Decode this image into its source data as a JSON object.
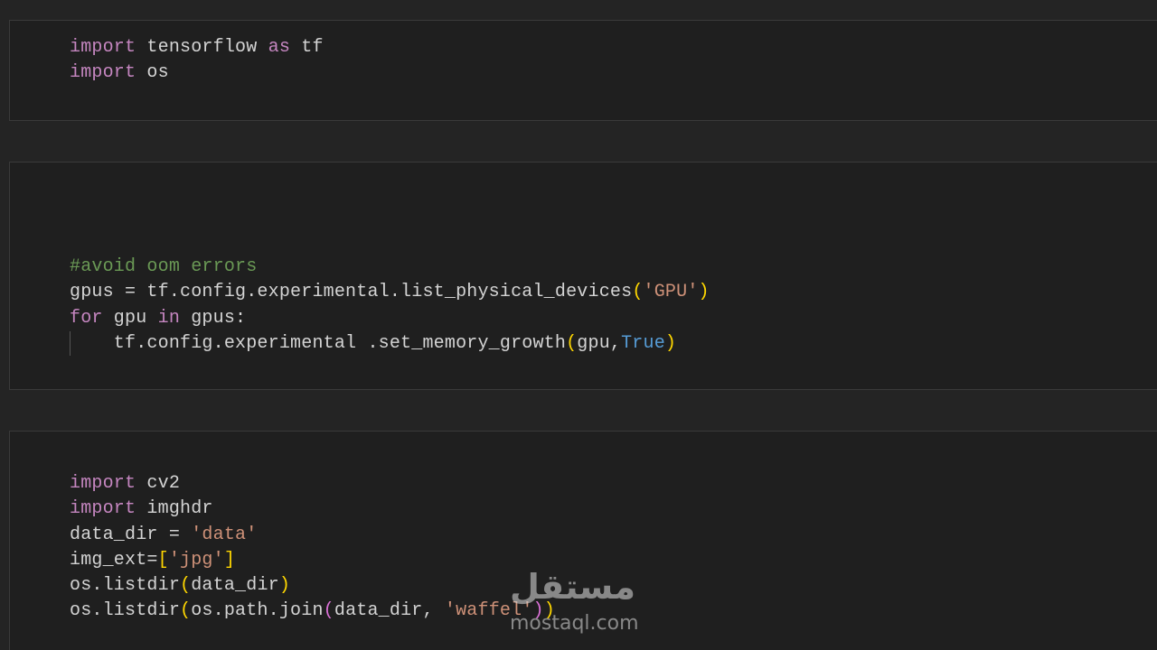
{
  "theme": {
    "background": "#242424",
    "cell_background": "#1f1f1f",
    "keyword": "#c586c0",
    "comment": "#6a9955",
    "string": "#ce9178",
    "constant": "#569cd6",
    "bracket_level_1": "#ffd700",
    "bracket_level_2": "#da70d6",
    "text": "#d4d4d4"
  },
  "cells": [
    {
      "lines": [
        [
          {
            "t": "import",
            "k": "kw"
          },
          {
            "t": " tensorflow ",
            "k": "p"
          },
          {
            "t": "as",
            "k": "kw"
          },
          {
            "t": " tf",
            "k": "p"
          }
        ],
        [
          {
            "t": "import",
            "k": "kw"
          },
          {
            "t": " os",
            "k": "p"
          }
        ]
      ]
    },
    {
      "lines": [
        [
          {
            "t": "#avoid oom errors",
            "k": "cm"
          }
        ],
        [
          {
            "t": "gpus = tf.config.experimental.list_physical_devices",
            "k": "p"
          },
          {
            "t": "(",
            "k": "b1"
          },
          {
            "t": "'GPU'",
            "k": "st"
          },
          {
            "t": ")",
            "k": "b1"
          }
        ],
        [
          {
            "t": "for",
            "k": "kw"
          },
          {
            "t": " gpu ",
            "k": "p"
          },
          {
            "t": "in",
            "k": "kw"
          },
          {
            "t": " gpus:",
            "k": "p"
          }
        ],
        [
          {
            "t": "    tf.config.experimental .set_memory_growth",
            "k": "p"
          },
          {
            "t": "(",
            "k": "b1"
          },
          {
            "t": "gpu,",
            "k": "p"
          },
          {
            "t": "True",
            "k": "cn"
          },
          {
            "t": ")",
            "k": "b1"
          }
        ]
      ]
    },
    {
      "lines": [
        [
          {
            "t": "import",
            "k": "kw"
          },
          {
            "t": " cv2",
            "k": "p"
          }
        ],
        [
          {
            "t": "import",
            "k": "kw"
          },
          {
            "t": " imghdr",
            "k": "p"
          }
        ],
        [
          {
            "t": "data_dir = ",
            "k": "p"
          },
          {
            "t": "'data'",
            "k": "st"
          }
        ],
        [
          {
            "t": "img_ext=",
            "k": "p"
          },
          {
            "t": "[",
            "k": "b1"
          },
          {
            "t": "'jpg'",
            "k": "st"
          },
          {
            "t": "]",
            "k": "b1"
          }
        ],
        [
          {
            "t": "os.listdir",
            "k": "p"
          },
          {
            "t": "(",
            "k": "b1"
          },
          {
            "t": "data_dir",
            "k": "p"
          },
          {
            "t": ")",
            "k": "b1"
          }
        ],
        [
          {
            "t": "os.listdir",
            "k": "p"
          },
          {
            "t": "(",
            "k": "b1"
          },
          {
            "t": "os.path.join",
            "k": "p"
          },
          {
            "t": "(",
            "k": "b2"
          },
          {
            "t": "data_dir, ",
            "k": "p"
          },
          {
            "t": "'waffel'",
            "k": "st"
          },
          {
            "t": ")",
            "k": "b2"
          },
          {
            "t": ")",
            "k": "b1"
          }
        ]
      ]
    }
  ],
  "watermark": {
    "arabic": "مستقل",
    "site": "mostaql.com"
  }
}
